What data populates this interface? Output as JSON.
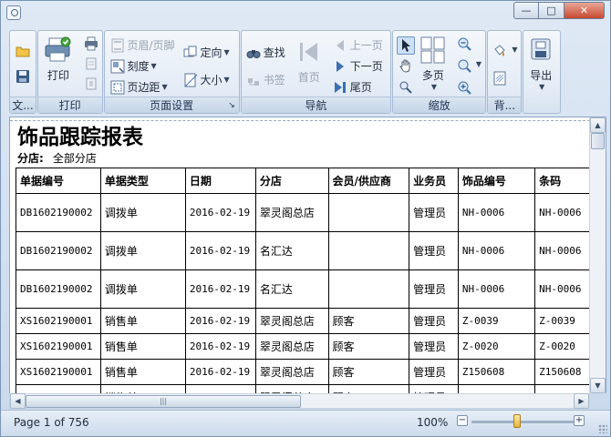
{
  "window": {
    "title": ""
  },
  "ribbon": {
    "file_group": {
      "label": "文..."
    },
    "print_group": {
      "label": "打印",
      "print": "打印"
    },
    "page_setup_group": {
      "label": "页面设置",
      "header_footer": "页眉/页脚",
      "orientation": "定向",
      "scale": "刻度",
      "margins": "页边距",
      "size": "大小"
    },
    "nav_group": {
      "label": "导航",
      "find": "查找",
      "bookmark": "书签",
      "first_page": "首页",
      "prev_page": "上一页",
      "next_page": "下一页",
      "last_page": "尾页"
    },
    "zoom_group": {
      "label": "缩放",
      "multi_page": "多页"
    },
    "background_group": {
      "label": "背..."
    },
    "export_group": {
      "export": "导出"
    }
  },
  "report": {
    "title": "饰品跟踪报表",
    "store_label": "分店:",
    "store_value": "全部分店",
    "columns": [
      "单据编号",
      "单据类型",
      "日期",
      "分店",
      "会员/供应商",
      "业务员",
      "饰品编号",
      "条码"
    ],
    "rows": [
      [
        "DB1602190002",
        "调拨单",
        "2016-02-19",
        "翠灵阁总店",
        "",
        "管理员",
        "NH-0006",
        "NH-0006"
      ],
      [
        "DB1602190002",
        "调拨单",
        "2016-02-19",
        "名汇达",
        "",
        "管理员",
        "NH-0006",
        "NH-0006"
      ],
      [
        "DB1602190002",
        "调拨单",
        "2016-02-19",
        "名汇达",
        "",
        "管理员",
        "NH-0006",
        "NH-0006"
      ],
      [
        "XS1602190001",
        "销售单",
        "2016-02-19",
        "翠灵阁总店",
        "顾客",
        "管理员",
        "Z-0039",
        "Z-0039"
      ],
      [
        "XS1602190001",
        "销售单",
        "2016-02-19",
        "翠灵阁总店",
        "顾客",
        "管理员",
        "Z-0020",
        "Z-0020"
      ],
      [
        "XS1602190001",
        "销售单",
        "2016-02-19",
        "翠灵阁总店",
        "顾客",
        "管理员",
        "Z150608",
        "Z150608"
      ],
      [
        "",
        "销售单",
        "",
        "翠灵阁总店",
        "顾客",
        "管理员",
        "",
        ""
      ]
    ]
  },
  "status": {
    "page_indicator": "Page 1 of 756",
    "zoom": "100%",
    "zoom_fraction": 0.45
  },
  "colors": {
    "accent": "#3c6fb0",
    "window_frame": "#c9d9ec"
  }
}
